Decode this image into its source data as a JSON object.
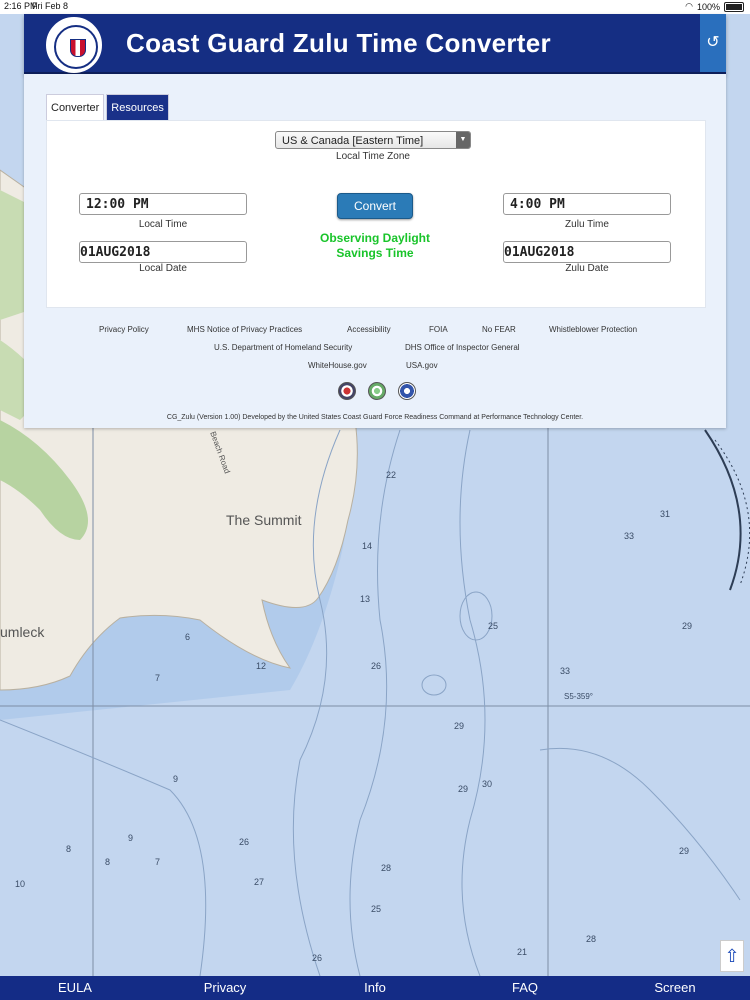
{
  "status_bar": {
    "time": "2:16 PM",
    "date": "Fri Feb 8",
    "battery": "100%"
  },
  "header": {
    "title": "Coast Guard Zulu Time Converter"
  },
  "tabs": [
    {
      "label": "Converter",
      "active": true
    },
    {
      "label": "Resources",
      "active": false
    }
  ],
  "converter": {
    "timezone_selected": "US & Canada [Eastern Time]",
    "timezone_label": "Local Time Zone",
    "local_time": "12:00 PM",
    "local_time_label": "Local Time",
    "local_date": "01AUG2018",
    "local_date_label": "Local Date",
    "zulu_time": "4:00 PM",
    "zulu_time_label": "Zulu Time",
    "zulu_date": "01AUG2018",
    "zulu_date_label": "Zulu Date",
    "convert_label": "Convert",
    "dst_line1": "Observing Daylight",
    "dst_line2": "Savings Time"
  },
  "footer": {
    "row1": [
      "Privacy Policy",
      "MHS Notice of Privacy Practices",
      "Accessibility",
      "FOIA",
      "No FEAR",
      "Whistleblower Protection"
    ],
    "row2": [
      "U.S. Department of Homeland Security",
      "DHS Office of Inspector General"
    ],
    "row3": [
      "WhiteHouse.gov",
      "USA.gov"
    ],
    "credit": "CG_Zulu (Version 1.00) Developed by the United States Coast Guard Force Readiness Command at Performance Technology Center."
  },
  "map": {
    "place1": "The Summit",
    "place2": "umleck",
    "road": "Beach Road",
    "bearing": "S5-359°",
    "depths": [
      "22",
      "31",
      "33",
      "14",
      "13",
      "25",
      "29",
      "6",
      "12",
      "26",
      "7",
      "33",
      "29",
      "9",
      "29",
      "30",
      "9",
      "8",
      "8",
      "7",
      "26",
      "28",
      "10",
      "27",
      "25",
      "29",
      "21",
      "28",
      "26"
    ]
  },
  "bottom_nav": [
    "EULA",
    "Privacy",
    "Info",
    "FAQ",
    "Screen"
  ],
  "colors": {
    "header": "#152e83",
    "accent": "#2b7bb7",
    "dst": "#19c42a"
  }
}
